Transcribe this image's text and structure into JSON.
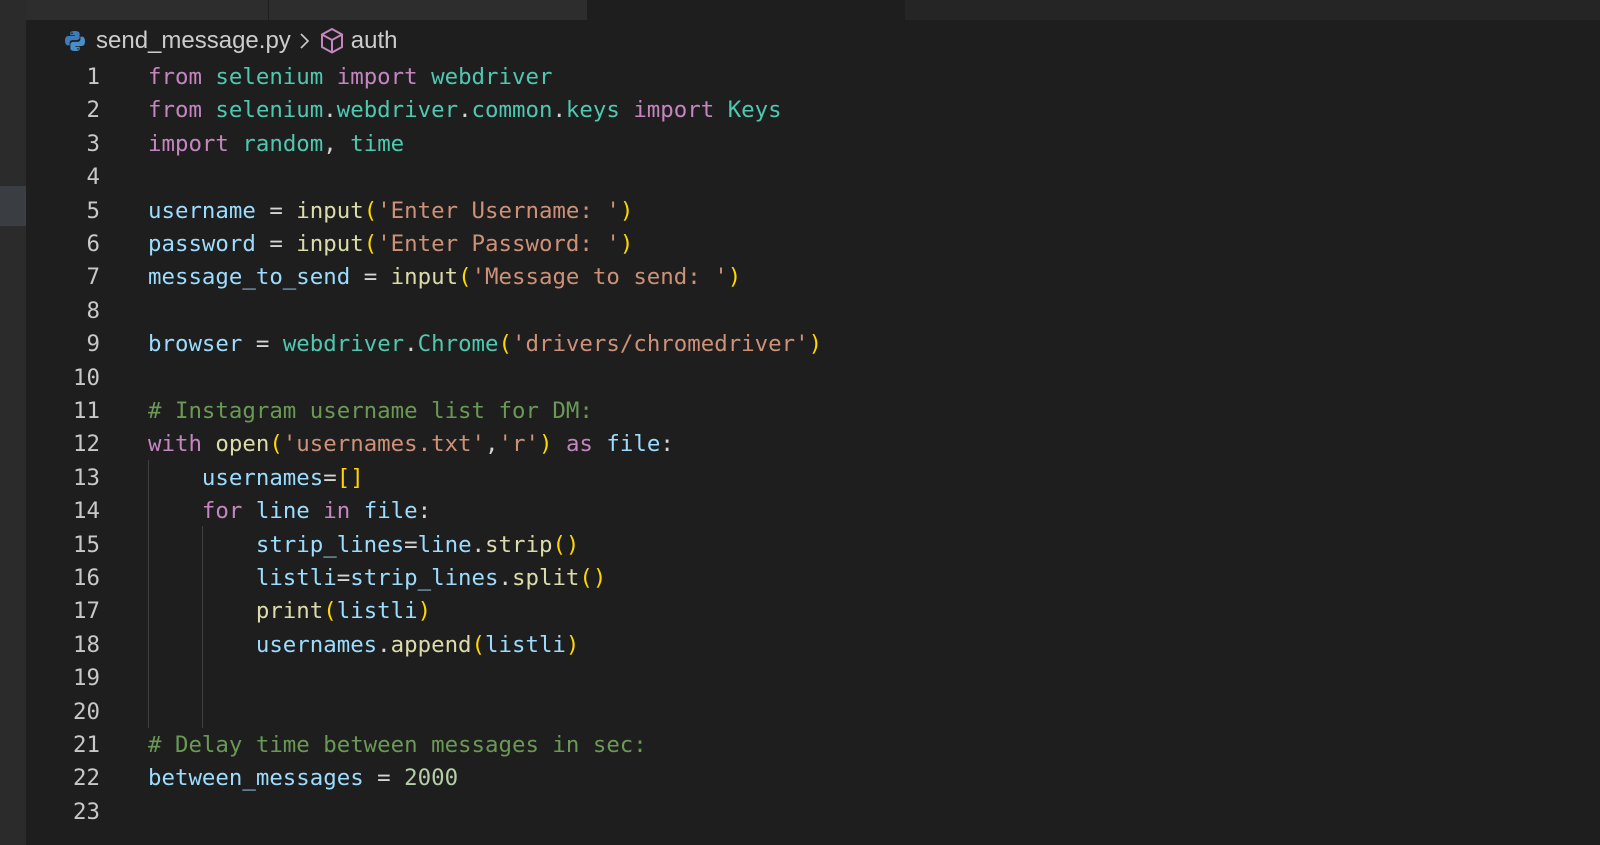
{
  "breadcrumb": {
    "file": "send_message.py",
    "symbol": "auth"
  },
  "code_lines": [
    {
      "n": "1",
      "tokens": [
        [
          "kw",
          "from"
        ],
        [
          "pl",
          " "
        ],
        [
          "mod",
          "selenium"
        ],
        [
          "pl",
          " "
        ],
        [
          "kw",
          "import"
        ],
        [
          "pl",
          " "
        ],
        [
          "mod",
          "webdriver"
        ]
      ]
    },
    {
      "n": "2",
      "tokens": [
        [
          "kw",
          "from"
        ],
        [
          "pl",
          " "
        ],
        [
          "mod",
          "selenium"
        ],
        [
          "pl",
          "."
        ],
        [
          "mod",
          "webdriver"
        ],
        [
          "pl",
          "."
        ],
        [
          "mod",
          "common"
        ],
        [
          "pl",
          "."
        ],
        [
          "mod",
          "keys"
        ],
        [
          "pl",
          " "
        ],
        [
          "kw",
          "import"
        ],
        [
          "pl",
          " "
        ],
        [
          "mod",
          "Keys"
        ]
      ]
    },
    {
      "n": "3",
      "tokens": [
        [
          "kw",
          "import"
        ],
        [
          "pl",
          " "
        ],
        [
          "mod",
          "random"
        ],
        [
          "pl",
          ", "
        ],
        [
          "mod",
          "time"
        ]
      ]
    },
    {
      "n": "4",
      "tokens": []
    },
    {
      "n": "5",
      "tokens": [
        [
          "var",
          "username"
        ],
        [
          "pl",
          " = "
        ],
        [
          "fn",
          "input"
        ],
        [
          "br1",
          "("
        ],
        [
          "str",
          "'Enter Username: '"
        ],
        [
          "br1",
          ")"
        ]
      ]
    },
    {
      "n": "6",
      "tokens": [
        [
          "var",
          "password"
        ],
        [
          "pl",
          " = "
        ],
        [
          "fn",
          "input"
        ],
        [
          "br1",
          "("
        ],
        [
          "str",
          "'Enter Password: '"
        ],
        [
          "br1",
          ")"
        ]
      ]
    },
    {
      "n": "7",
      "tokens": [
        [
          "var",
          "message_to_send"
        ],
        [
          "pl",
          " = "
        ],
        [
          "fn",
          "input"
        ],
        [
          "br1",
          "("
        ],
        [
          "str",
          "'Message to send: '"
        ],
        [
          "br1",
          ")"
        ]
      ]
    },
    {
      "n": "8",
      "tokens": []
    },
    {
      "n": "9",
      "tokens": [
        [
          "var",
          "browser"
        ],
        [
          "pl",
          " = "
        ],
        [
          "mod",
          "webdriver"
        ],
        [
          "pl",
          "."
        ],
        [
          "mod",
          "Chrome"
        ],
        [
          "br1",
          "("
        ],
        [
          "str",
          "'drivers/chromedriver'"
        ],
        [
          "br1",
          ")"
        ]
      ]
    },
    {
      "n": "10",
      "tokens": []
    },
    {
      "n": "11",
      "tokens": [
        [
          "com",
          "# Instagram username list for DM:"
        ]
      ]
    },
    {
      "n": "12",
      "tokens": [
        [
          "kw",
          "with"
        ],
        [
          "pl",
          " "
        ],
        [
          "fn",
          "open"
        ],
        [
          "br1",
          "("
        ],
        [
          "str",
          "'usernames.txt'"
        ],
        [
          "pl",
          ","
        ],
        [
          "str",
          "'r'"
        ],
        [
          "br1",
          ")"
        ],
        [
          "pl",
          " "
        ],
        [
          "kw",
          "as"
        ],
        [
          "pl",
          " "
        ],
        [
          "var",
          "file"
        ],
        [
          "pl",
          ":"
        ]
      ]
    },
    {
      "n": "13",
      "tokens": [
        [
          "pl",
          "    "
        ],
        [
          "var",
          "usernames"
        ],
        [
          "pl",
          "="
        ],
        [
          "br1",
          "[]"
        ]
      ]
    },
    {
      "n": "14",
      "tokens": [
        [
          "pl",
          "    "
        ],
        [
          "kw",
          "for"
        ],
        [
          "pl",
          " "
        ],
        [
          "var",
          "line"
        ],
        [
          "pl",
          " "
        ],
        [
          "kw",
          "in"
        ],
        [
          "pl",
          " "
        ],
        [
          "var",
          "file"
        ],
        [
          "pl",
          ":"
        ]
      ]
    },
    {
      "n": "15",
      "tokens": [
        [
          "pl",
          "        "
        ],
        [
          "var",
          "strip_lines"
        ],
        [
          "pl",
          "="
        ],
        [
          "var",
          "line"
        ],
        [
          "pl",
          "."
        ],
        [
          "fn",
          "strip"
        ],
        [
          "br1",
          "()"
        ]
      ]
    },
    {
      "n": "16",
      "tokens": [
        [
          "pl",
          "        "
        ],
        [
          "var",
          "listli"
        ],
        [
          "pl",
          "="
        ],
        [
          "var",
          "strip_lines"
        ],
        [
          "pl",
          "."
        ],
        [
          "fn",
          "split"
        ],
        [
          "br1",
          "()"
        ]
      ]
    },
    {
      "n": "17",
      "tokens": [
        [
          "pl",
          "        "
        ],
        [
          "fn",
          "print"
        ],
        [
          "br1",
          "("
        ],
        [
          "var",
          "listli"
        ],
        [
          "br1",
          ")"
        ]
      ]
    },
    {
      "n": "18",
      "tokens": [
        [
          "pl",
          "        "
        ],
        [
          "var",
          "usernames"
        ],
        [
          "pl",
          "."
        ],
        [
          "fn",
          "append"
        ],
        [
          "br1",
          "("
        ],
        [
          "var",
          "listli"
        ],
        [
          "br1",
          ")"
        ]
      ]
    },
    {
      "n": "19",
      "tokens": []
    },
    {
      "n": "20",
      "tokens": []
    },
    {
      "n": "21",
      "tokens": [
        [
          "com",
          "# Delay time between messages in sec:"
        ]
      ]
    },
    {
      "n": "22",
      "tokens": [
        [
          "var",
          "between_messages"
        ],
        [
          "pl",
          " = "
        ],
        [
          "num",
          "2000"
        ]
      ]
    },
    {
      "n": "23",
      "tokens": []
    }
  ],
  "icons": {
    "file_icon": "python-icon",
    "symbol_icon": "cube-icon"
  }
}
